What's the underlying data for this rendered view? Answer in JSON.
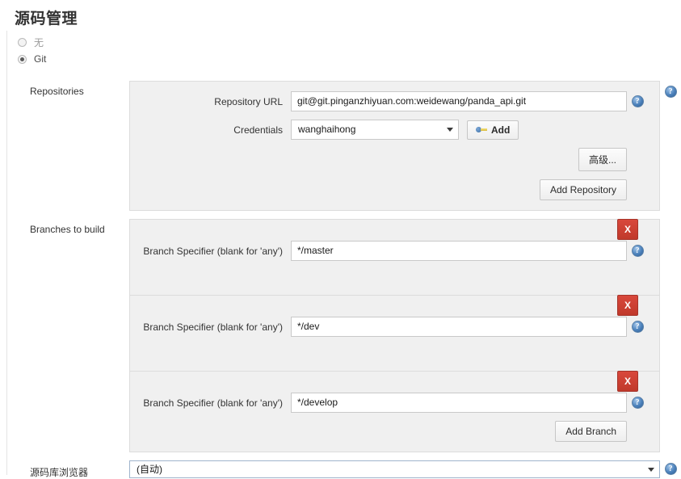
{
  "page": {
    "title": "源码管理"
  },
  "scm_type": {
    "options": [
      {
        "label": "无",
        "selected": false
      },
      {
        "label": "Git",
        "selected": true
      }
    ]
  },
  "repositories": {
    "section_label": "Repositories",
    "repository_url": {
      "label": "Repository URL",
      "value": "git@git.pinganzhiyuan.com:weidewang/panda_api.git"
    },
    "credentials": {
      "label": "Credentials",
      "value": "wanghaihong",
      "add_button": "Add"
    },
    "advanced_button": "高级...",
    "add_repository_button": "Add Repository"
  },
  "branches": {
    "section_label": "Branches to build",
    "specifier_label": "Branch Specifier (blank for 'any')",
    "delete_label": "X",
    "items": [
      {
        "value": "*/master"
      },
      {
        "value": "*/dev"
      },
      {
        "value": "*/develop"
      }
    ],
    "add_branch_button": "Add Branch"
  },
  "repo_browser": {
    "label": "源码库浏览器",
    "value": "(自动)"
  },
  "colors": {
    "delete_red": "#c0392b",
    "help_blue": "#4b81bb",
    "panel_bg": "#f0f0f0",
    "panel_border": "#dcdcdc"
  }
}
